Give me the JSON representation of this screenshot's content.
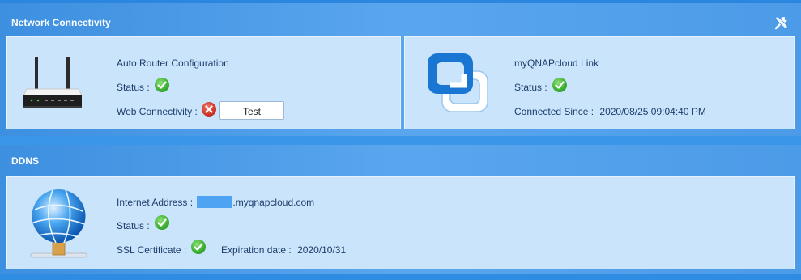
{
  "network": {
    "title": "Network Connectivity",
    "router": {
      "title": "Auto Router Configuration",
      "status_label": "Status :",
      "web_label": "Web Connectivity :",
      "test_label": "Test"
    },
    "cloud": {
      "title": "myQNAPcloud Link",
      "status_label": "Status :",
      "since_label": "Connected Since :",
      "since_value": "2020/08/25 09:04:40 PM"
    }
  },
  "ddns": {
    "title": "DDNS",
    "address_label": "Internet Address :",
    "address_suffix": ".myqnapcloud.com",
    "status_label": "Status :",
    "ssl_label": "SSL Certificate :",
    "expiration_label": "Expiration date :",
    "expiration_value": "2020/10/31"
  },
  "icons": {
    "settings": "wrench-screwdriver-icon",
    "router": "router-icon",
    "cloud": "myqnapcloud-logo-icon",
    "globe": "network-globe-icon",
    "ok": "status-ok-icon",
    "error": "status-error-icon"
  },
  "colors": {
    "background": "#2f8ce3",
    "panel": "#c9e4fb",
    "text": "#1f3d6c",
    "ok": "#3fb134",
    "error": "#d1392a",
    "masked": "#4ea3f3"
  }
}
